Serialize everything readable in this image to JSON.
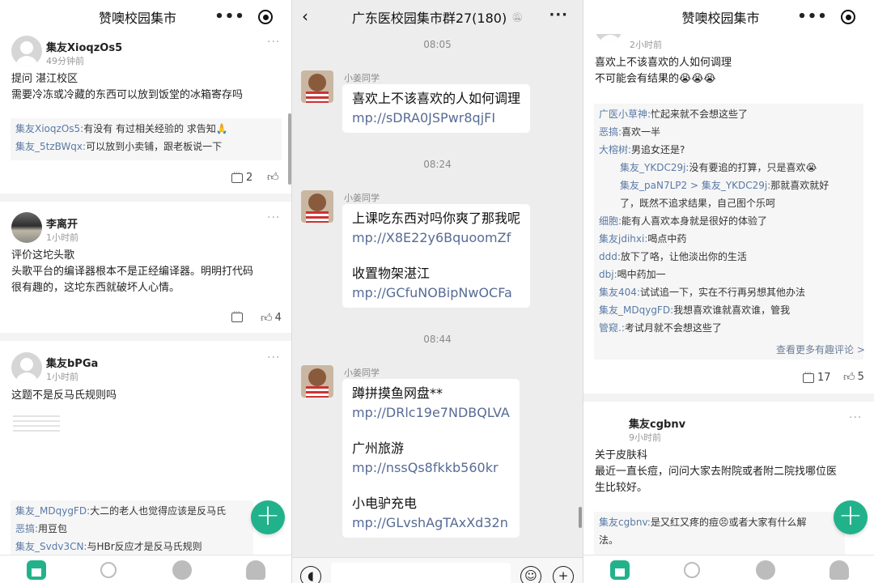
{
  "left": {
    "header": {
      "title": "赞噢校园集市"
    },
    "posts": [
      {
        "user": "集友XioqzOs5",
        "time": "49分钟前",
        "lines": [
          "提问 湛江校区",
          "需要冷冻或冷藏的东西可以放到饭堂的冰箱寄存吗"
        ],
        "comments": [
          {
            "user": "集友XioqzOs5:",
            "text": "有没有 有过相关经验的 求告知🙏"
          },
          {
            "user": "集友_5tzBWqx:",
            "text": "可以放到小卖铺，跟老板说一下"
          }
        ],
        "comment_count": "2"
      },
      {
        "user": "李离开",
        "time": "1小时前",
        "lines": [
          "评价这坨头歌",
          "头歌平台的编译器根本不是正经编译器。明明打代码",
          "很有趣的，这坨东西就破坏人心情。"
        ],
        "like_count": "4"
      },
      {
        "user": "集友bPGa",
        "time": "1小时前",
        "lines": [
          "这题不是反马氏规则吗"
        ],
        "comments": [
          {
            "user": "集友_MDqygFD:",
            "text": "大二的老人也觉得应该是反马氏"
          },
          {
            "user": "恶搞:",
            "text": "用豆包"
          },
          {
            "user": "集友_Svdv3CN:",
            "text": "与HBr反应才是反马氏规则"
          }
        ]
      }
    ]
  },
  "chat": {
    "title": "广东医校园集市群27(180)",
    "sender": "小姜同学",
    "groups": [
      {
        "time": "08:05",
        "lines": [
          {
            "t": "喜欢上不该喜欢的人如何调理"
          },
          {
            "l": "mp://sDRA0JSPwr8qjFI"
          }
        ]
      },
      {
        "time": "08:24",
        "lines": [
          {
            "t": "上课吃东西对吗你爽了那我呢"
          },
          {
            "l": "mp://X8E22y6BquoomZf"
          },
          {
            "g": 1
          },
          {
            "t": "收置物架湛江"
          },
          {
            "l": "mp://GCfuNOBipNwOCFa"
          }
        ]
      },
      {
        "time": "08:44",
        "lines": [
          {
            "t": "蹲拼摸鱼网盘**"
          },
          {
            "l": "mp://DRlc19e7NDBQLVA"
          },
          {
            "g": 1
          },
          {
            "t": "广州旅游"
          },
          {
            "l": "mp://nssQs8fkkb560kr"
          },
          {
            "g": 1
          },
          {
            "t": "小电驴充电"
          },
          {
            "l": "mp://GLvshAgTAxXd32n"
          }
        ]
      }
    ]
  },
  "right": {
    "header": {
      "title": "赞噢校园集市"
    },
    "top_post": {
      "time": "2小时前",
      "lines": [
        "喜欢上不该喜欢的人如何调理",
        "不可能会有结果的😭😭😭"
      ],
      "comments": [
        {
          "user": "广医小草神:",
          "text": "忙起来就不会想这些了"
        },
        {
          "user": "恶搞:",
          "text": "喜欢一半"
        },
        {
          "user": "大榕树:",
          "text": "男追女还是?"
        },
        {
          "user": "集友_YKDC29j:",
          "text": "没有要追的打算，只是喜欢😭",
          "reply": true
        },
        {
          "user": "集友_paN7LP2 > 集友_YKDC29j:",
          "text": "那就喜欢就好",
          "reply": true
        },
        {
          "user": "",
          "text": "了，既然不追求结果，自己图个乐呵",
          "reply": true
        },
        {
          "user": "细胞:",
          "text": "能有人喜欢本身就是很好的体验了"
        },
        {
          "user": "集友jdihxi:",
          "text": "喝点中药"
        },
        {
          "user": "ddd:",
          "text": "放下了咯，让他淡出你的生活"
        },
        {
          "user": "dbj:",
          "text": "喝中药加一"
        },
        {
          "user": "集友404:",
          "text": "试试追一下，实在不行再另想其他办法"
        },
        {
          "user": "集友_MDqygFD:",
          "text": "我想喜欢谁就喜欢谁，管我"
        },
        {
          "user": "管窥.:",
          "text": "考试月就不会想这些了"
        }
      ],
      "more_label": "查看更多有趣评论 >",
      "comment_count": "17",
      "like_count": "5"
    },
    "post2": {
      "user": "集友cgbnv",
      "time": "9小时前",
      "lines": [
        "关于皮肤科",
        "最近一直长痘，问问大家去附院或者附二院找哪位医",
        "生比较好。"
      ],
      "comments": [
        {
          "user": "集友cgbnv:",
          "text": "是又红又疼的痘😣或者大家有什么解"
        },
        {
          "user": "",
          "text": "法。"
        }
      ]
    }
  },
  "icons": {
    "fab": "plus-icon",
    "back": "chevron-left-icon",
    "voice": "voice-icon",
    "emoji": "emoji-icon",
    "add": "plus-circle-icon"
  },
  "accent": "#22b28b",
  "link_color": "#576b95"
}
